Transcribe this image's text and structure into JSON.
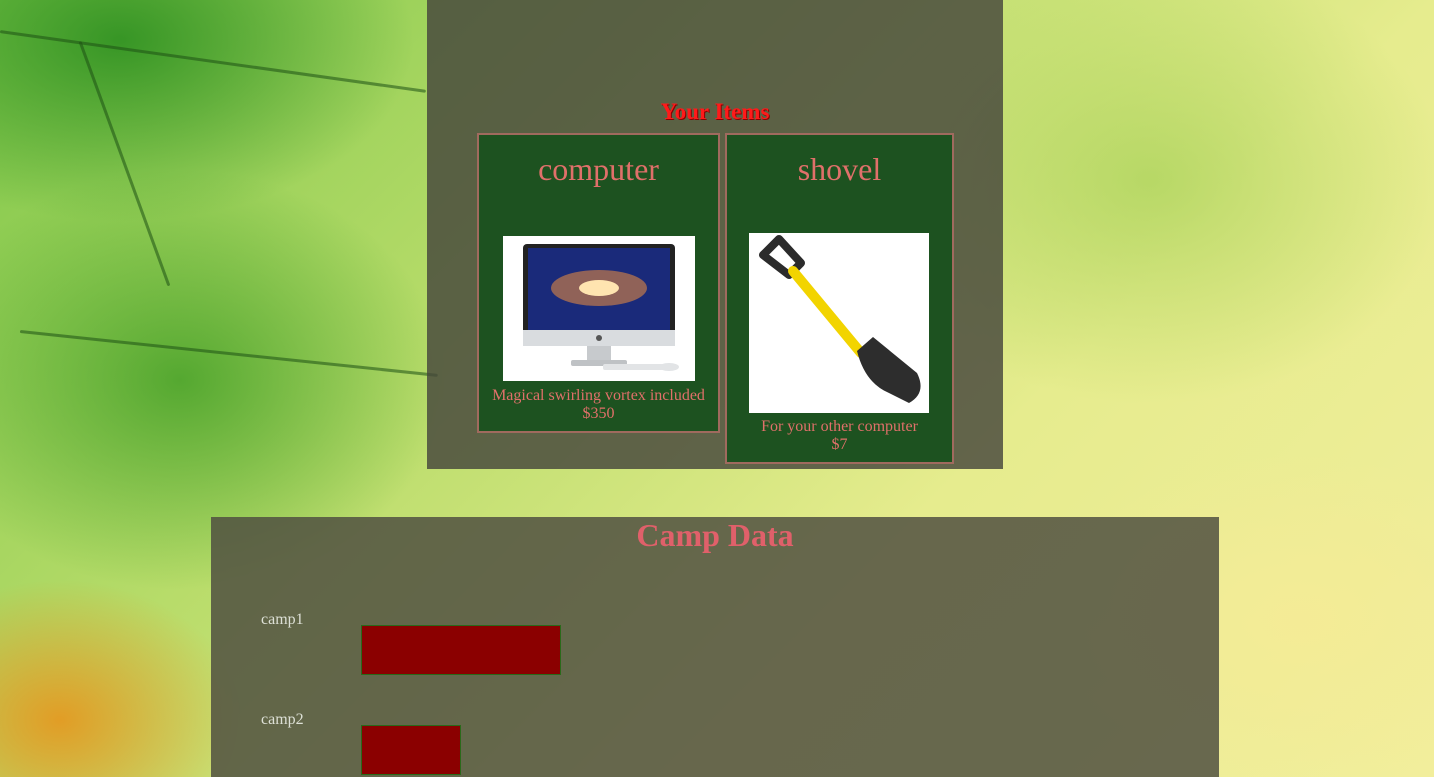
{
  "items": {
    "title": "Your Items",
    "cards": [
      {
        "name": "computer",
        "image": "computer-image",
        "description": "Magical swirling vortex included",
        "price": "$350"
      },
      {
        "name": "shovel",
        "image": "shovel-image",
        "description": "For your other computer",
        "price": "$7"
      }
    ]
  },
  "camp": {
    "title": "Camp Data",
    "chart_data": {
      "type": "bar",
      "categories": [
        "camp1",
        "camp2"
      ],
      "values": [
        2,
        1
      ],
      "colors": {
        "bar": "#8b0000"
      }
    }
  }
}
